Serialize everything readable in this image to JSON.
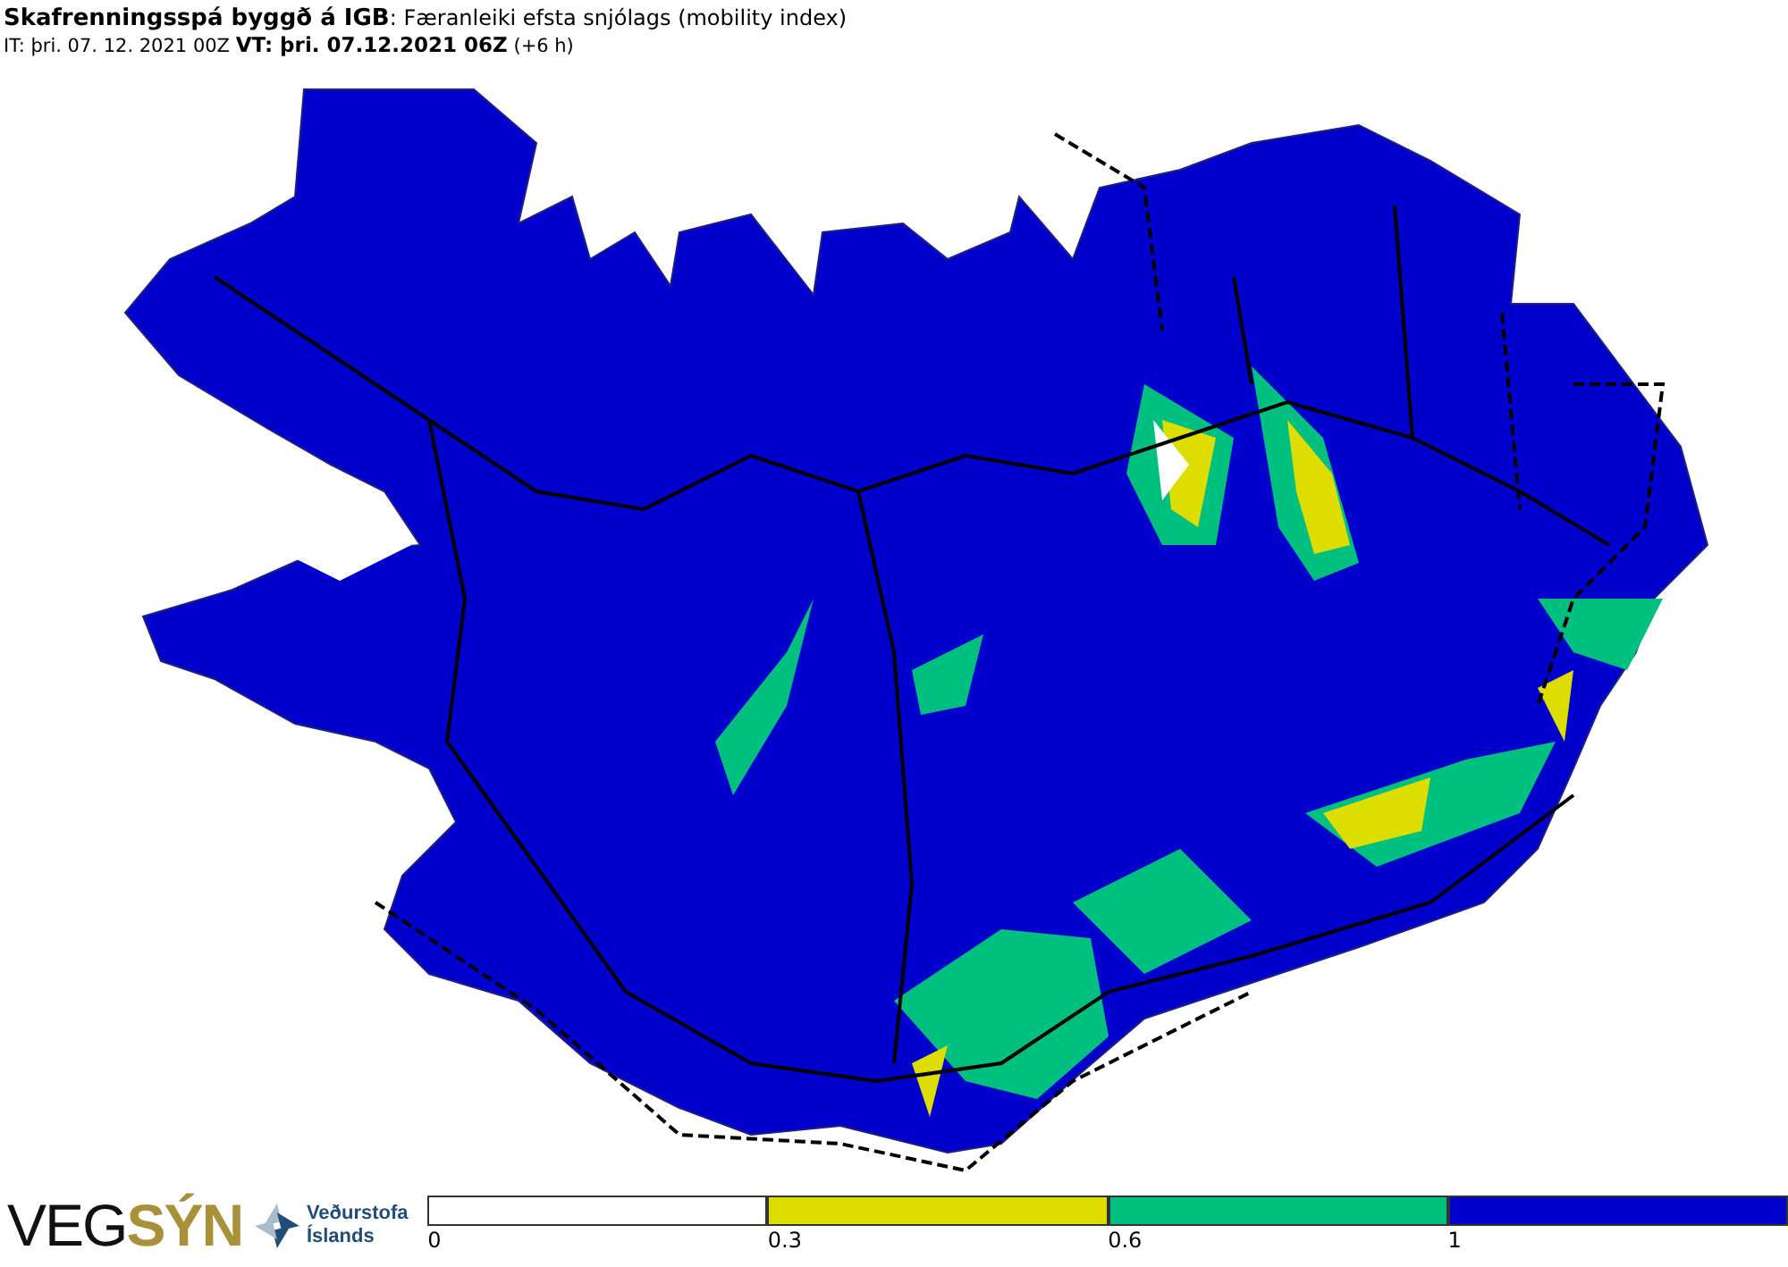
{
  "header": {
    "title": "**Skafrenningsspá byggð á IGB**: Færanleiki efsta snjólags (mobility index)",
    "time": "IT: þri. 07. 12. 2021 00Z **VT: þri. 07.12.2021 06Z** (+6 h)"
  },
  "logos": {
    "vegsyn": "VEG**SÝN**",
    "vedurstofa": "Veðurstofa Íslands"
  },
  "legend": [
    {
      "label": "0",
      "color": "#ffffff"
    },
    {
      "label": "0.3",
      "color": "#dddd00"
    },
    {
      "label": "0.6",
      "color": "#00c080"
    },
    {
      "label": "1",
      "color": "#0000cc"
    }
  ]
}
